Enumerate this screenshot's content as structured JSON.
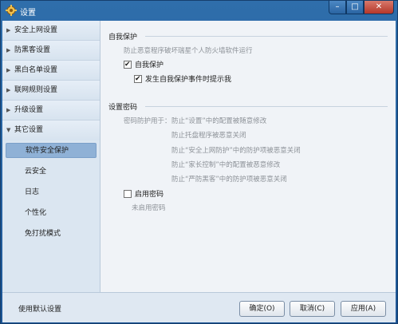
{
  "window": {
    "title": "设置",
    "controls": {
      "minimize": "–",
      "maximize": "□",
      "close": "✕"
    }
  },
  "sidebar": {
    "categories": [
      {
        "label": "安全上网设置"
      },
      {
        "label": "防黑客设置"
      },
      {
        "label": "黑白名单设置"
      },
      {
        "label": "联网规则设置"
      },
      {
        "label": "升级设置"
      },
      {
        "label": "其它设置"
      }
    ],
    "subitems": [
      {
        "label": "软件安全保护"
      },
      {
        "label": "云安全"
      },
      {
        "label": "日志"
      },
      {
        "label": "个性化"
      },
      {
        "label": "免打扰模式"
      }
    ]
  },
  "self_protect": {
    "title": "自我保护",
    "desc": "防止恶意程序破坏瑞星个人防火墙软件运行",
    "enable_label": "自我保护",
    "notify_label": "发生自我保护事件时提示我"
  },
  "password": {
    "title": "设置密码",
    "intro": "密码防护用于：",
    "lines": [
      "防止“设置”中的配置被随意修改",
      "防止托盘程序被恶意关闭",
      "防止“安全上网防护”中的防护项被恶意关闭",
      "防止“家长控制”中的配置被恶意修改",
      "防止“严防黑客”中的防护项被恶意关闭"
    ],
    "enable_label": "启用密码",
    "status": "未启用密码"
  },
  "footer": {
    "default_label": "使用默认设置",
    "ok_label": "确定(O)",
    "cancel_label": "取消(C)",
    "apply_label": "应用(A)"
  }
}
